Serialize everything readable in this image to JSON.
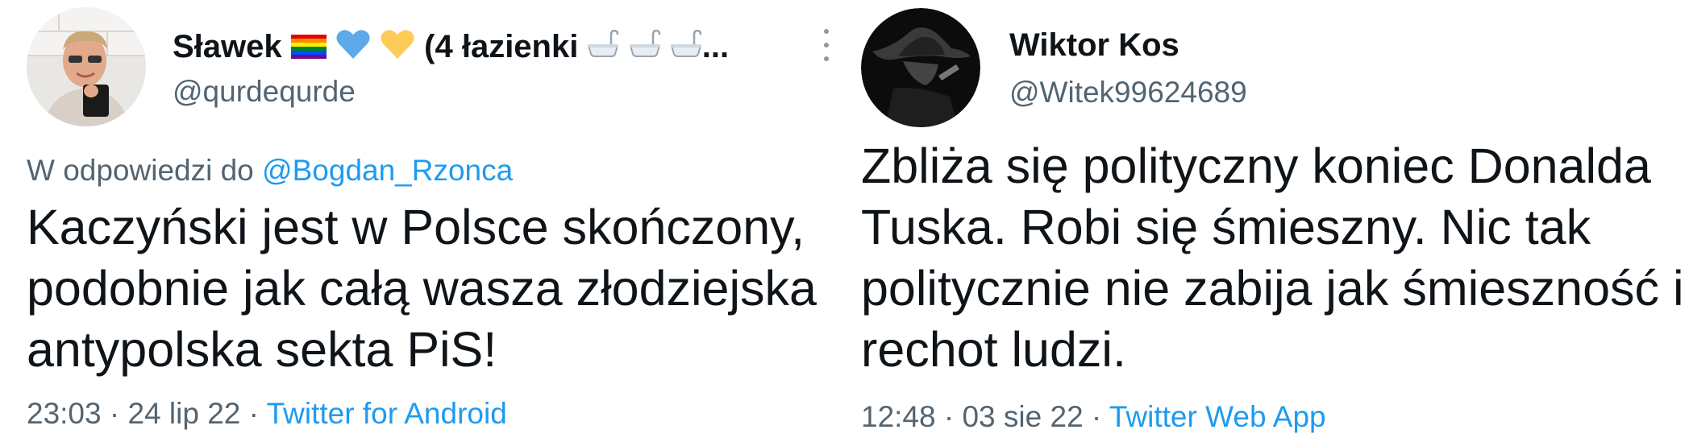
{
  "tweets": [
    {
      "display_name": "Sławek",
      "name_emoji": [
        "rainbow-flag",
        "blue-heart",
        "yellow-heart"
      ],
      "name_suffix": "(4 łazienki",
      "name_suffix_emoji": [
        "bathtub",
        "bathtub",
        "bathtub"
      ],
      "name_ellipsis": "...",
      "handle": "@qurdequrde",
      "reply_prefix": "W odpowiedzi do",
      "reply_to": "@Bogdan_Rzonca",
      "text": "Kaczyński jest w Polsce skończony,\npodobnie jak całą wasza złodziejska\nantypolska sekta PiS!",
      "time": "23:03",
      "separator": " · ",
      "date": "24 lip 22",
      "source": "Twitter for Android"
    },
    {
      "display_name": "Wiktor Kos",
      "handle": "@Witek99624689",
      "text": "Zbliża się polityczny koniec Donalda\nTuska. Robi się śmieszny. Nic tak\npolitycznie nie zabija jak śmieszność i\nrechot ludzi.",
      "time": "12:48",
      "separator": " · ",
      "date": "03 sie 22",
      "source": "Twitter Web App"
    }
  ],
  "colors": {
    "text_primary": "#0f1419",
    "text_secondary": "#536471",
    "link": "#1d9bf0",
    "background": "#ffffff"
  },
  "icons": [
    "more-vertical-icon",
    "rainbow-flag-icon",
    "blue-heart-icon",
    "yellow-heart-icon",
    "bathtub-icon"
  ]
}
